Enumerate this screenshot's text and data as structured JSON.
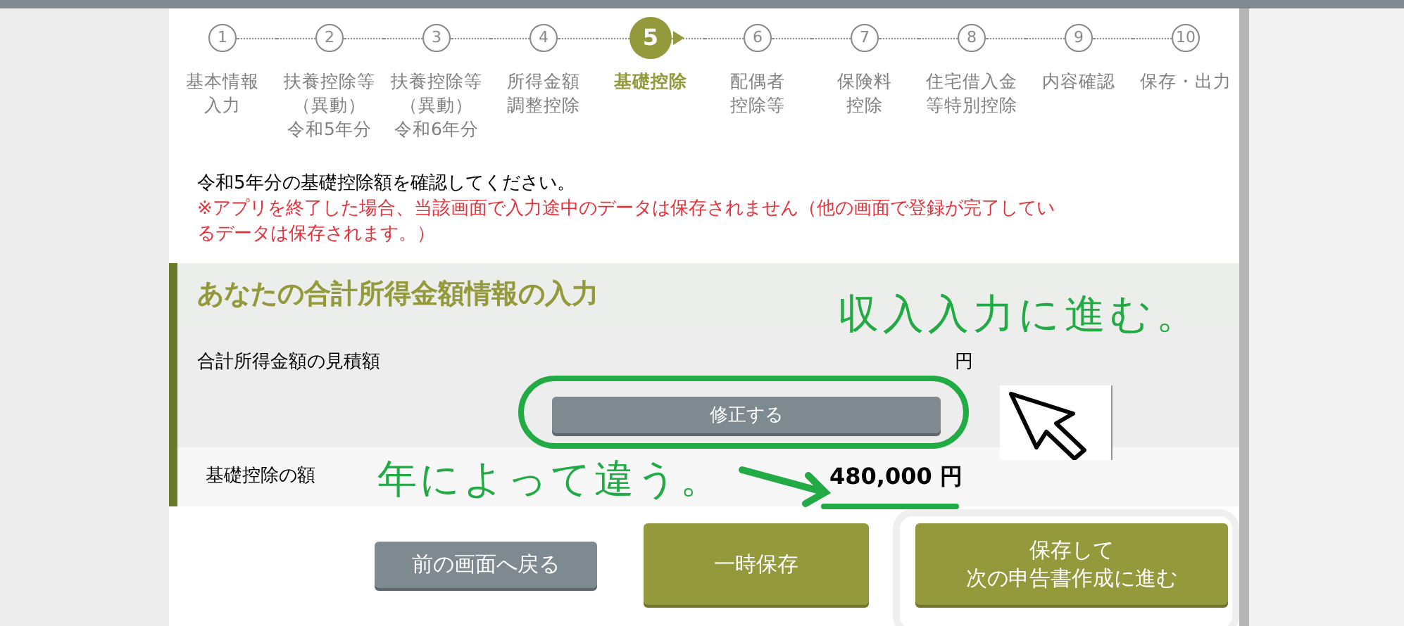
{
  "steps": [
    {
      "number": "1",
      "label": [
        "基本情報",
        "入力"
      ],
      "selected": false
    },
    {
      "number": "2",
      "label": [
        "扶養控除等",
        "（異動）",
        "令和5年分"
      ],
      "selected": false
    },
    {
      "number": "3",
      "label": [
        "扶養控除等",
        "（異動）",
        "令和6年分"
      ],
      "selected": false
    },
    {
      "number": "4",
      "label": [
        "所得金額",
        "調整控除"
      ],
      "selected": false
    },
    {
      "number": "5",
      "label": [
        "基礎控除"
      ],
      "selected": true
    },
    {
      "number": "6",
      "label": [
        "配偶者",
        "控除等"
      ],
      "selected": false
    },
    {
      "number": "7",
      "label": [
        "保険料",
        "控除"
      ],
      "selected": false
    },
    {
      "number": "8",
      "label": [
        "住宅借入金",
        "等特別控除"
      ],
      "selected": false
    },
    {
      "number": "9",
      "label": [
        "内容確認"
      ],
      "selected": false
    },
    {
      "number": "10",
      "label": [
        "保存・出力"
      ],
      "selected": false
    }
  ],
  "notice": "令和5年分の基礎控除額を確認してください。",
  "warning": "※アプリを終了した場合、当該画面で入力途中のデータは保存されません（他の画面で登録が完了しているデータは保存されます。）",
  "section": {
    "title": "あなたの合計所得金額情報の入力",
    "estimate_label": "合計所得金額の見積額",
    "estimate_unit": "円",
    "edit_button": "修正する",
    "deduction_label": "基礎控除の額",
    "deduction_value": "480,000",
    "deduction_unit": "円"
  },
  "buttons": [
    {
      "label": [
        "前の画面へ戻る"
      ],
      "kind": "back"
    },
    {
      "label": [
        "一時保存"
      ],
      "kind": "primary"
    },
    {
      "label": [
        "保存して",
        "次の申告書作成に進む"
      ],
      "kind": "primary"
    }
  ],
  "annotations": [
    {
      "text": "収入入力に進む。"
    },
    {
      "text": "年によって違う。"
    }
  ]
}
